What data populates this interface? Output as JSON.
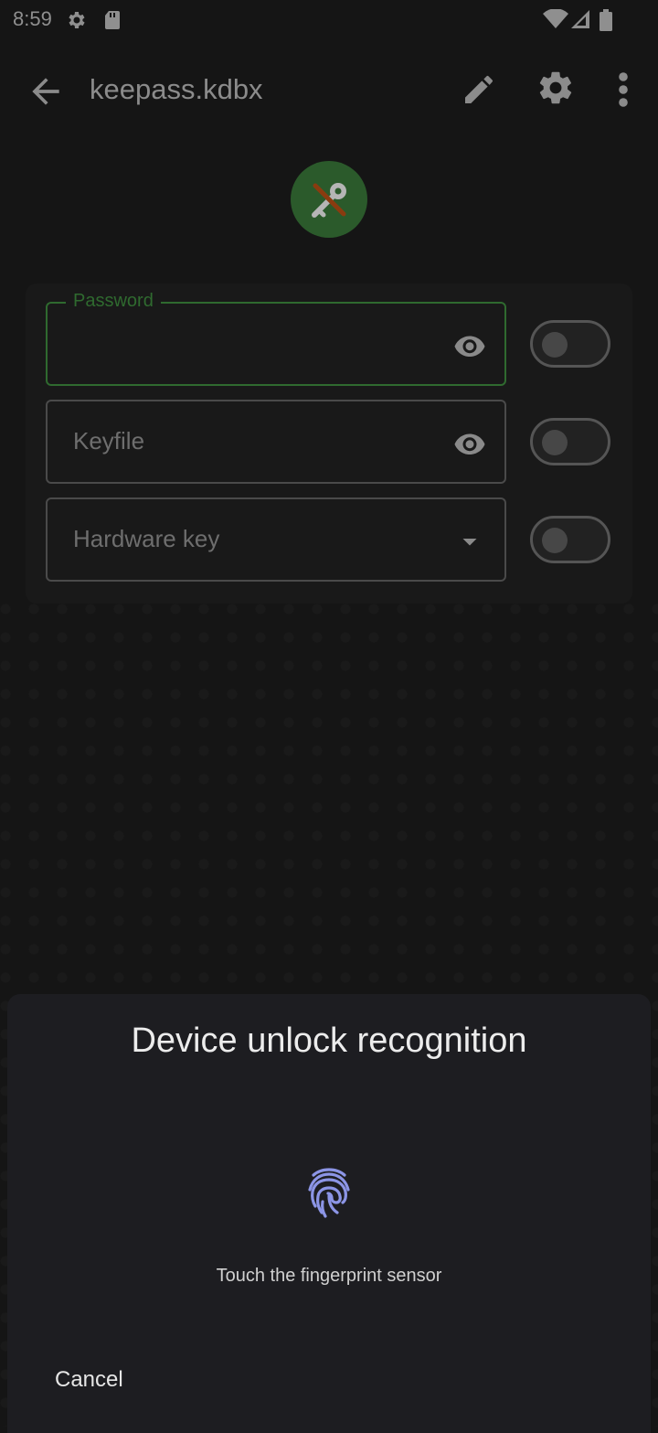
{
  "status_bar": {
    "time": "8:59",
    "left_icons": [
      "gear-icon",
      "sd-card-icon"
    ],
    "right_icons": [
      "wifi-icon",
      "cellular-signal-icon",
      "battery-icon"
    ]
  },
  "app_bar": {
    "title": "keepass.kdbx",
    "icons": [
      "back-arrow-icon",
      "pencil-icon",
      "gear-icon",
      "more-vert-icon"
    ]
  },
  "lock_badge": {
    "icon": "key-off-icon",
    "colors": {
      "background": "#2b5a2b",
      "slash": "#8a3b0f",
      "key": "#b5b5b5"
    }
  },
  "credentials": {
    "password": {
      "label": "Password",
      "value": "",
      "icon": "eye-icon",
      "toggle_on": false
    },
    "keyfile": {
      "label": "Keyfile",
      "value": "",
      "icon": "eye-icon",
      "toggle_on": false
    },
    "hardware_key": {
      "label": "Hardware key",
      "value": "",
      "icon": "dropdown-arrow-icon",
      "toggle_on": false
    }
  },
  "biometric_sheet": {
    "title": "Device unlock recognition",
    "icon": "fingerprint-icon",
    "subtitle": "Touch the fingerprint sensor",
    "cancel_label": "Cancel"
  },
  "colors": {
    "accent": "#2f6a2f",
    "sheet_background": "#1d1d21",
    "fingerprint": "#8c95e6"
  }
}
